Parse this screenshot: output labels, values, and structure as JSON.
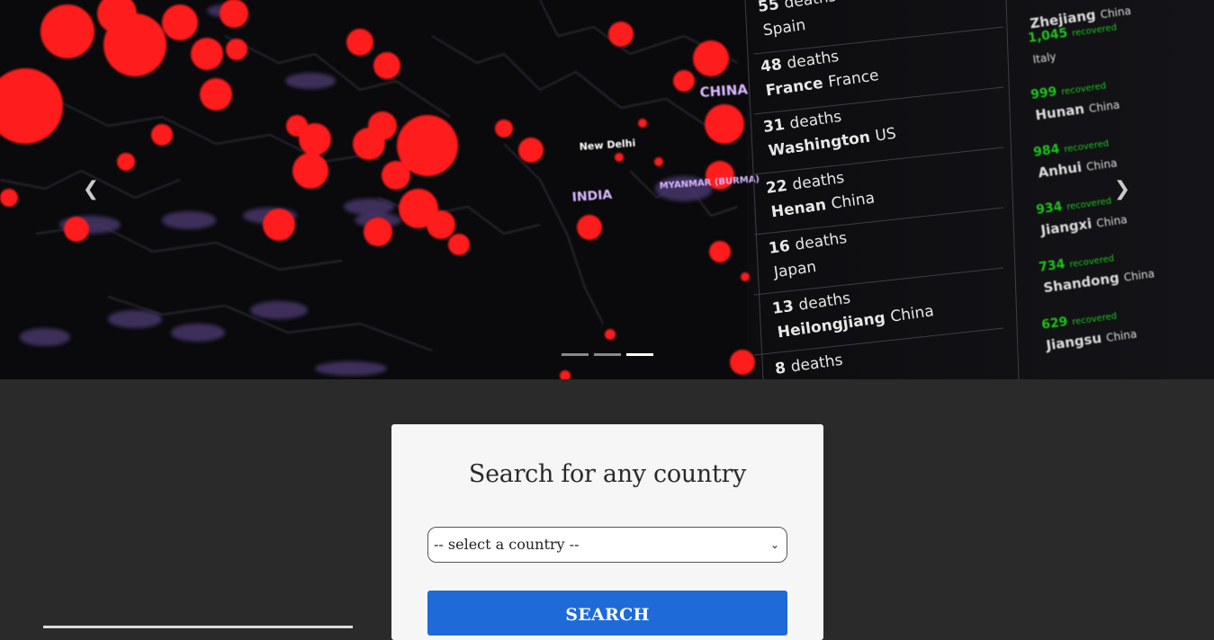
{
  "carousel": {
    "prev_icon": "chevron-left-icon",
    "next_icon": "chevron-right-icon",
    "prev_glyph": "❮",
    "next_glyph": "❯",
    "slide_count": 3,
    "active_slide": 3,
    "image_text": {
      "map_labels": [
        "CHINA",
        "INDIA",
        "New Delhi",
        "MYANMAR (BURMA)"
      ],
      "deaths": [
        {
          "count": "55",
          "word": "deaths",
          "place_bold": "",
          "place": "Spain"
        },
        {
          "count": "48",
          "word": "deaths",
          "place_bold": "France",
          "place": "France"
        },
        {
          "count": "31",
          "word": "deaths",
          "place_bold": "Washington",
          "place": "US"
        },
        {
          "count": "22",
          "word": "deaths",
          "place_bold": "Henan",
          "place": "China"
        },
        {
          "count": "16",
          "word": "deaths",
          "place_bold": "",
          "place": "Japan"
        },
        {
          "count": "13",
          "word": "deaths",
          "place_bold": "Heilongjiang",
          "place": "China"
        },
        {
          "count": "8",
          "word": "deaths",
          "place_bold": "",
          "place": ""
        }
      ],
      "recovered": [
        {
          "count": "",
          "place_bold": "Zhejiang",
          "place": "China"
        },
        {
          "count": "1,045",
          "word": "recovered",
          "place_bold": "",
          "place": "Italy"
        },
        {
          "count": "999",
          "word": "recovered",
          "place_bold": "Hunan",
          "place": "China"
        },
        {
          "count": "984",
          "word": "recovered",
          "place_bold": "Anhui",
          "place": "China"
        },
        {
          "count": "934",
          "word": "recovered",
          "place_bold": "Jiangxi",
          "place": "China"
        },
        {
          "count": "734",
          "word": "recovered",
          "place_bold": "Shandong",
          "place": "China"
        },
        {
          "count": "629",
          "word": "recovered",
          "place_bold": "Jiangsu",
          "place": "China"
        }
      ]
    }
  },
  "search_card": {
    "title": "Search for any country",
    "select_value": "-- select a country --",
    "select_chevron": "⌄",
    "button_label": "SEARCH"
  },
  "colors": {
    "page_bg": "#2a2a2a",
    "card_bg": "#f6f6f6",
    "button_bg": "#1e6ad8",
    "hotspot_red": "#ff1a1a",
    "recovered_green": "#1fc21f"
  }
}
